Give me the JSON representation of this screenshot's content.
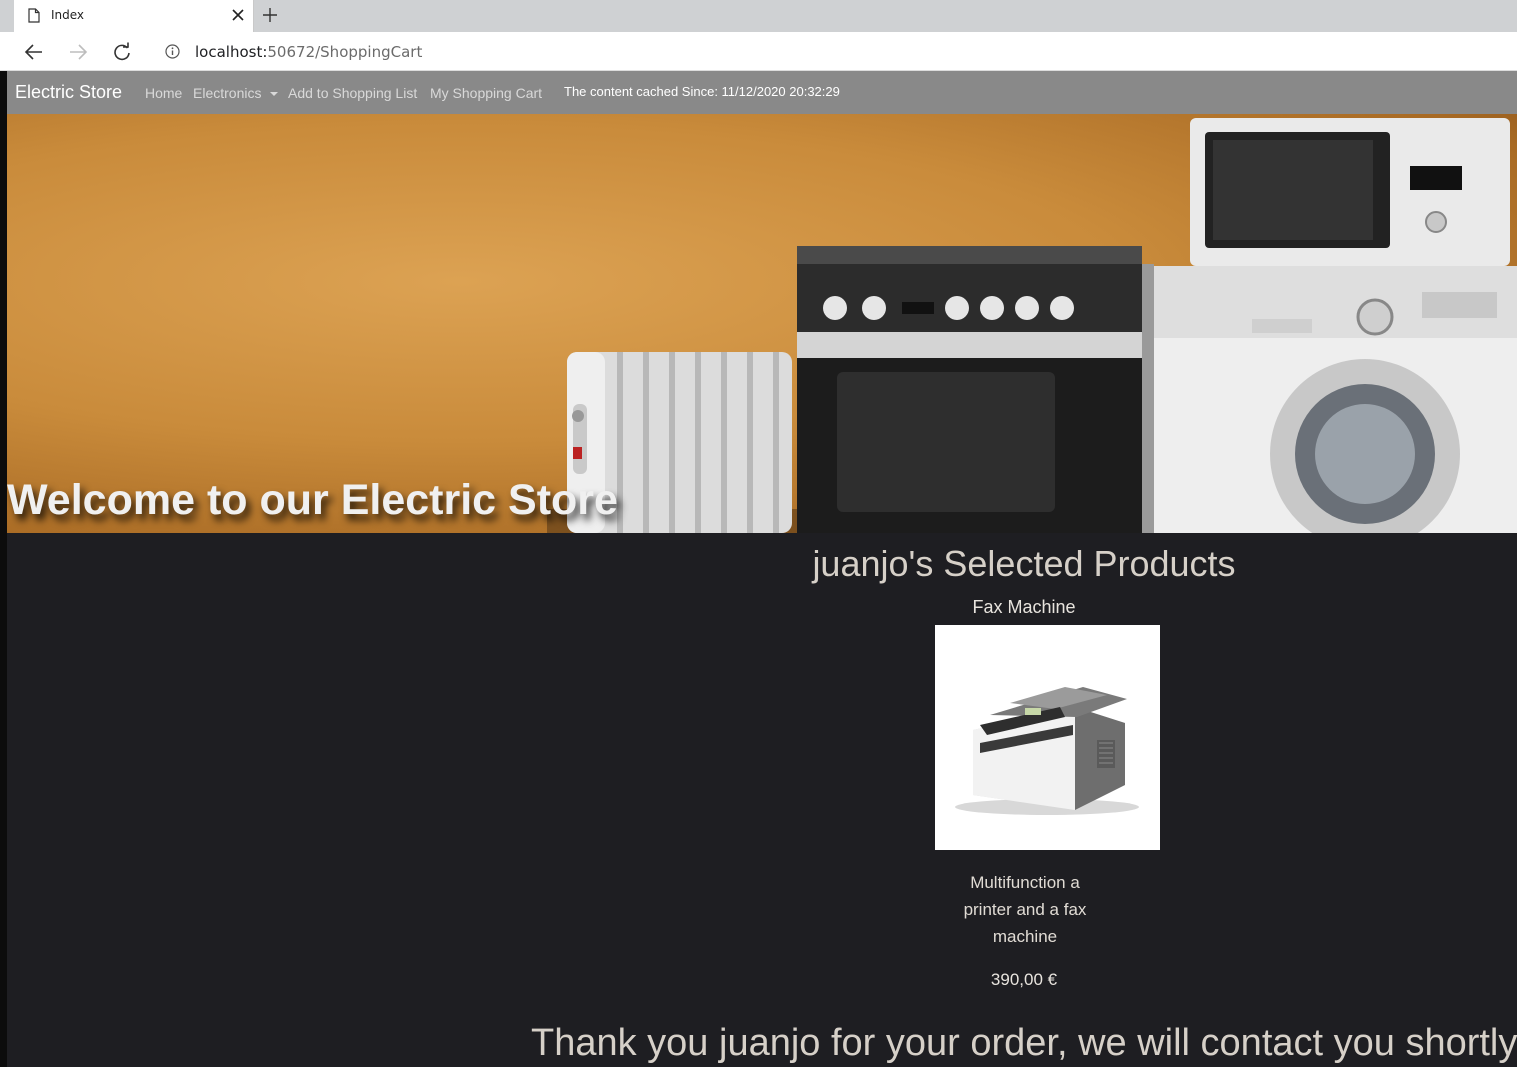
{
  "browser": {
    "tab_title": "Index",
    "url_host": "localhost:",
    "url_path": "50672/ShoppingCart"
  },
  "navbar": {
    "brand": "Electric Store",
    "links": [
      "Home",
      "Electronics",
      "Add to Shopping List",
      "My Shopping Cart"
    ],
    "cached_text": "The content cached Since: 11/12/2020 20:32:29"
  },
  "hero": {
    "title": "Welcome to our Electric Store"
  },
  "cart": {
    "heading": "juanjo's Selected Products",
    "product": {
      "name": "Fax Machine",
      "description": "Multifunction a printer and a fax machine",
      "price": "390,00 €"
    },
    "thank_you": "Thank you juanjo for your order, we will contact you shortly."
  }
}
